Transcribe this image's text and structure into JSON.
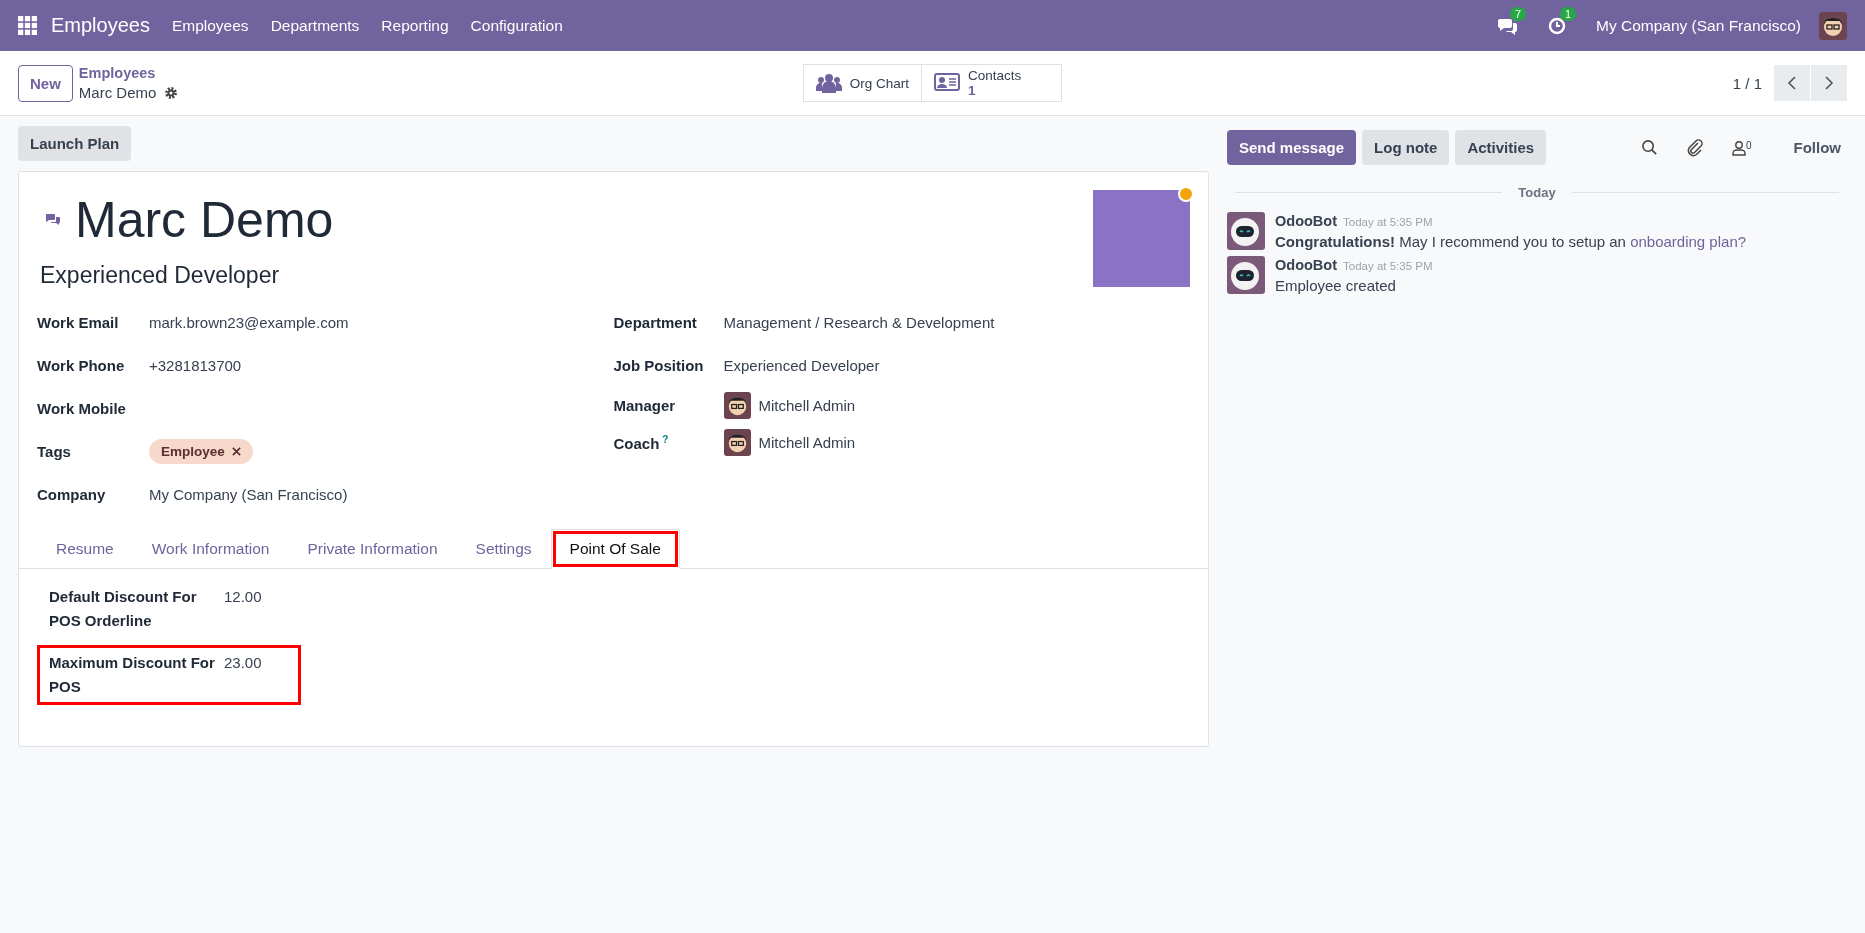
{
  "navbar": {
    "app_name": "Employees",
    "menu": [
      "Employees",
      "Departments",
      "Reporting",
      "Configuration"
    ],
    "messages_count": "7",
    "activities_count": "1",
    "company": "My Company (San Francisco)"
  },
  "control_panel": {
    "new_button": "New",
    "breadcrumb": "Employees",
    "record": "Marc Demo",
    "smart_buttons": [
      {
        "kind": "org",
        "label": "Org Chart"
      },
      {
        "kind": "contacts",
        "label": "Contacts",
        "value": "1"
      }
    ],
    "pager": "1 / 1"
  },
  "launch_plan": "Launch Plan",
  "employee": {
    "name": "Marc Demo",
    "job_title": "Experienced Developer",
    "online": true,
    "left_fields": [
      {
        "kind": "text",
        "label": "Work Email",
        "value": "mark.brown23@example.com"
      },
      {
        "kind": "text",
        "label": "Work Phone",
        "value": "+3281813700"
      },
      {
        "kind": "text",
        "label": "Work Mobile"
      },
      {
        "kind": "tag",
        "label": "Tags",
        "value": "Employee"
      },
      {
        "kind": "text",
        "label": "Company",
        "value": "My Company (San Francisco)"
      }
    ],
    "right_fields": [
      {
        "kind": "text",
        "label": "Department",
        "value": "Management / Research & Development"
      },
      {
        "kind": "text",
        "label": "Job Position",
        "value": "Experienced Developer"
      },
      {
        "kind": "user",
        "label": "Manager",
        "value": "Mitchell Admin"
      },
      {
        "kind": "user",
        "label": "Coach",
        "help": "?",
        "value": "Mitchell Admin"
      }
    ]
  },
  "tabs": [
    {
      "label": "Resume",
      "selected": false,
      "highlighted": false
    },
    {
      "label": "Work Information",
      "selected": false,
      "highlighted": false
    },
    {
      "label": "Private Information",
      "selected": false,
      "highlighted": false
    },
    {
      "label": "Settings",
      "selected": false,
      "highlighted": false
    },
    {
      "label": "Point Of Sale",
      "selected": true,
      "highlighted": true
    }
  ],
  "pos_fields": [
    {
      "label": "Default Discount For POS Orderline",
      "value": "12.00",
      "highlighted": false
    },
    {
      "label": "Maximum Discount For POS",
      "value": "23.00",
      "highlighted": true
    }
  ],
  "chatter": {
    "buttons": [
      {
        "label": "Send message",
        "selected": true
      },
      {
        "label": "Log note",
        "selected": false
      },
      {
        "label": "Activities",
        "selected": false
      }
    ],
    "followers_count": "0",
    "follow": "Follow",
    "date_separator": "Today",
    "messages": [
      {
        "author": "OdooBot",
        "time": "Today at 5:35 PM",
        "text": "**Congratulations!** May I recommend you to setup an ",
        "link": "onboarding plan?"
      },
      {
        "author": "OdooBot",
        "time": "Today at 5:35 PM",
        "text": "Employee created"
      }
    ]
  }
}
